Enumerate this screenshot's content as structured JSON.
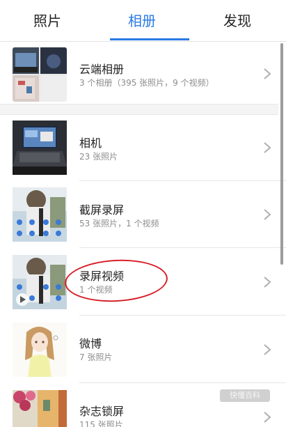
{
  "tabs": [
    {
      "label": "照片"
    },
    {
      "label": "相册"
    },
    {
      "label": "发现"
    }
  ],
  "active_tab": "相册",
  "accent": "#2a7ae4",
  "albums": [
    {
      "title": "云端相册",
      "subtitle": "3 个相册（395 张照片，9 个视频）",
      "thumbnail": "cloud-collage-thumbnail"
    },
    {
      "title": "相机",
      "subtitle": "23 张照片",
      "thumbnail": "laptop-photo-thumbnail"
    },
    {
      "title": "截屏录屏",
      "subtitle": "53 张照片，1 个视频",
      "thumbnail": "screenshot-illustration-thumbnail"
    },
    {
      "title": "录屏视频",
      "subtitle": "1 个视频",
      "thumbnail": "screen-recording-thumbnail"
    },
    {
      "title": "微博",
      "subtitle": "7 张照片",
      "thumbnail": "anime-girl-thumbnail"
    },
    {
      "title": "杂志锁屏",
      "subtitle": "115 张照片",
      "thumbnail": "flowers-street-thumbnail"
    }
  ],
  "annotation_color": "#d71f28",
  "watermark": "快懂百科"
}
